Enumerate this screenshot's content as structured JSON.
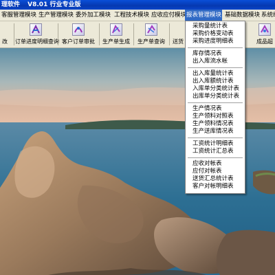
{
  "window": {
    "title_app": "理软件",
    "title_version": "V8.01 行业专业版"
  },
  "menubar": {
    "items": [
      {
        "label": "客服管理模块"
      },
      {
        "label": "生产管理模块"
      },
      {
        "label": "委外加工模块"
      },
      {
        "label": "工程技术模块"
      },
      {
        "label": "应收应付模块"
      },
      {
        "label": "报表管理模块",
        "active": true
      },
      {
        "label": "基础数据模块"
      },
      {
        "label": "系统维"
      }
    ],
    "active_color": "#316ac5"
  },
  "toolbar": {
    "buttons": [
      {
        "label": "改",
        "icon": "edit-icon"
      },
      {
        "label": "订单进度明细查询",
        "icon": "order-progress-icon"
      },
      {
        "label": "客户订单审批",
        "icon": "order-approve-icon"
      },
      {
        "label": "生产单生成",
        "icon": "production-create-icon"
      },
      {
        "label": "生产单查询",
        "icon": "production-query-icon"
      },
      {
        "label": "送货",
        "icon": "delivery-icon"
      },
      {
        "label": "成品超",
        "icon": "product-icon"
      }
    ]
  },
  "report_menu": {
    "groups": [
      [
        "采购量统计表",
        "采购价格变动表",
        "采购进度明细表"
      ],
      [
        "库存情况表",
        "出入库流水帐"
      ],
      [
        "出入库量统计表",
        "出入库额统计表",
        "入库单分类统计表",
        "出库单分类统计表"
      ],
      [
        "生产情况表",
        "生产领料对照表",
        "生产领料情况表",
        "生产送库情况表"
      ],
      [
        "工资统计明细表",
        "工资统计汇总表"
      ],
      [
        "应收对帐表",
        "应付对帐表",
        "送货汇总统计表",
        "客户对帐明细表"
      ]
    ]
  }
}
